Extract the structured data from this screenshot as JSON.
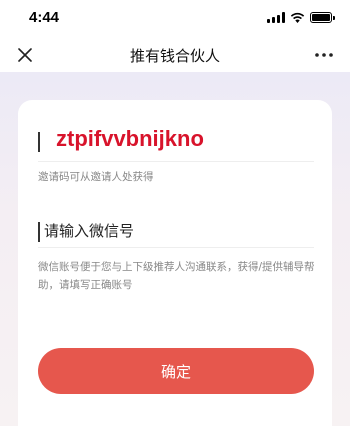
{
  "status_bar": {
    "time": "4:44"
  },
  "nav": {
    "title": "推有钱合伙人",
    "close_icon": "close-icon",
    "more_icon": "more-icon"
  },
  "form": {
    "invite_code": {
      "value": "ztpifvvbnijkno",
      "hint": "邀请码可从邀请人处获得"
    },
    "wechat": {
      "placeholder": "请输入微信号",
      "hint": "微信账号便于您与上下级推荐人沟通联系，获得/提供辅导帮助，请填写正确账号"
    },
    "confirm_label": "确定"
  },
  "colors": {
    "accent": "#e6574d",
    "code_text": "#d8132b",
    "page_bg": "#f4eef3"
  }
}
